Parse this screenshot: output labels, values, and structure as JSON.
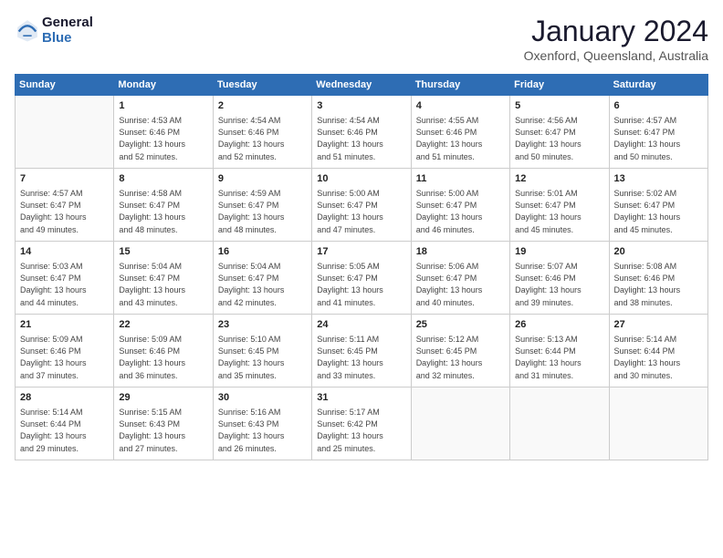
{
  "header": {
    "logo_line1": "General",
    "logo_line2": "Blue",
    "month": "January 2024",
    "location": "Oxenford, Queensland, Australia"
  },
  "weekdays": [
    "Sunday",
    "Monday",
    "Tuesday",
    "Wednesday",
    "Thursday",
    "Friday",
    "Saturday"
  ],
  "weeks": [
    [
      {
        "day": "",
        "info": ""
      },
      {
        "day": "1",
        "info": "Sunrise: 4:53 AM\nSunset: 6:46 PM\nDaylight: 13 hours\nand 52 minutes."
      },
      {
        "day": "2",
        "info": "Sunrise: 4:54 AM\nSunset: 6:46 PM\nDaylight: 13 hours\nand 52 minutes."
      },
      {
        "day": "3",
        "info": "Sunrise: 4:54 AM\nSunset: 6:46 PM\nDaylight: 13 hours\nand 51 minutes."
      },
      {
        "day": "4",
        "info": "Sunrise: 4:55 AM\nSunset: 6:46 PM\nDaylight: 13 hours\nand 51 minutes."
      },
      {
        "day": "5",
        "info": "Sunrise: 4:56 AM\nSunset: 6:47 PM\nDaylight: 13 hours\nand 50 minutes."
      },
      {
        "day": "6",
        "info": "Sunrise: 4:57 AM\nSunset: 6:47 PM\nDaylight: 13 hours\nand 50 minutes."
      }
    ],
    [
      {
        "day": "7",
        "info": "Sunrise: 4:57 AM\nSunset: 6:47 PM\nDaylight: 13 hours\nand 49 minutes."
      },
      {
        "day": "8",
        "info": "Sunrise: 4:58 AM\nSunset: 6:47 PM\nDaylight: 13 hours\nand 48 minutes."
      },
      {
        "day": "9",
        "info": "Sunrise: 4:59 AM\nSunset: 6:47 PM\nDaylight: 13 hours\nand 48 minutes."
      },
      {
        "day": "10",
        "info": "Sunrise: 5:00 AM\nSunset: 6:47 PM\nDaylight: 13 hours\nand 47 minutes."
      },
      {
        "day": "11",
        "info": "Sunrise: 5:00 AM\nSunset: 6:47 PM\nDaylight: 13 hours\nand 46 minutes."
      },
      {
        "day": "12",
        "info": "Sunrise: 5:01 AM\nSunset: 6:47 PM\nDaylight: 13 hours\nand 45 minutes."
      },
      {
        "day": "13",
        "info": "Sunrise: 5:02 AM\nSunset: 6:47 PM\nDaylight: 13 hours\nand 45 minutes."
      }
    ],
    [
      {
        "day": "14",
        "info": "Sunrise: 5:03 AM\nSunset: 6:47 PM\nDaylight: 13 hours\nand 44 minutes."
      },
      {
        "day": "15",
        "info": "Sunrise: 5:04 AM\nSunset: 6:47 PM\nDaylight: 13 hours\nand 43 minutes."
      },
      {
        "day": "16",
        "info": "Sunrise: 5:04 AM\nSunset: 6:47 PM\nDaylight: 13 hours\nand 42 minutes."
      },
      {
        "day": "17",
        "info": "Sunrise: 5:05 AM\nSunset: 6:47 PM\nDaylight: 13 hours\nand 41 minutes."
      },
      {
        "day": "18",
        "info": "Sunrise: 5:06 AM\nSunset: 6:47 PM\nDaylight: 13 hours\nand 40 minutes."
      },
      {
        "day": "19",
        "info": "Sunrise: 5:07 AM\nSunset: 6:46 PM\nDaylight: 13 hours\nand 39 minutes."
      },
      {
        "day": "20",
        "info": "Sunrise: 5:08 AM\nSunset: 6:46 PM\nDaylight: 13 hours\nand 38 minutes."
      }
    ],
    [
      {
        "day": "21",
        "info": "Sunrise: 5:09 AM\nSunset: 6:46 PM\nDaylight: 13 hours\nand 37 minutes."
      },
      {
        "day": "22",
        "info": "Sunrise: 5:09 AM\nSunset: 6:46 PM\nDaylight: 13 hours\nand 36 minutes."
      },
      {
        "day": "23",
        "info": "Sunrise: 5:10 AM\nSunset: 6:45 PM\nDaylight: 13 hours\nand 35 minutes."
      },
      {
        "day": "24",
        "info": "Sunrise: 5:11 AM\nSunset: 6:45 PM\nDaylight: 13 hours\nand 33 minutes."
      },
      {
        "day": "25",
        "info": "Sunrise: 5:12 AM\nSunset: 6:45 PM\nDaylight: 13 hours\nand 32 minutes."
      },
      {
        "day": "26",
        "info": "Sunrise: 5:13 AM\nSunset: 6:44 PM\nDaylight: 13 hours\nand 31 minutes."
      },
      {
        "day": "27",
        "info": "Sunrise: 5:14 AM\nSunset: 6:44 PM\nDaylight: 13 hours\nand 30 minutes."
      }
    ],
    [
      {
        "day": "28",
        "info": "Sunrise: 5:14 AM\nSunset: 6:44 PM\nDaylight: 13 hours\nand 29 minutes."
      },
      {
        "day": "29",
        "info": "Sunrise: 5:15 AM\nSunset: 6:43 PM\nDaylight: 13 hours\nand 27 minutes."
      },
      {
        "day": "30",
        "info": "Sunrise: 5:16 AM\nSunset: 6:43 PM\nDaylight: 13 hours\nand 26 minutes."
      },
      {
        "day": "31",
        "info": "Sunrise: 5:17 AM\nSunset: 6:42 PM\nDaylight: 13 hours\nand 25 minutes."
      },
      {
        "day": "",
        "info": ""
      },
      {
        "day": "",
        "info": ""
      },
      {
        "day": "",
        "info": ""
      }
    ]
  ]
}
